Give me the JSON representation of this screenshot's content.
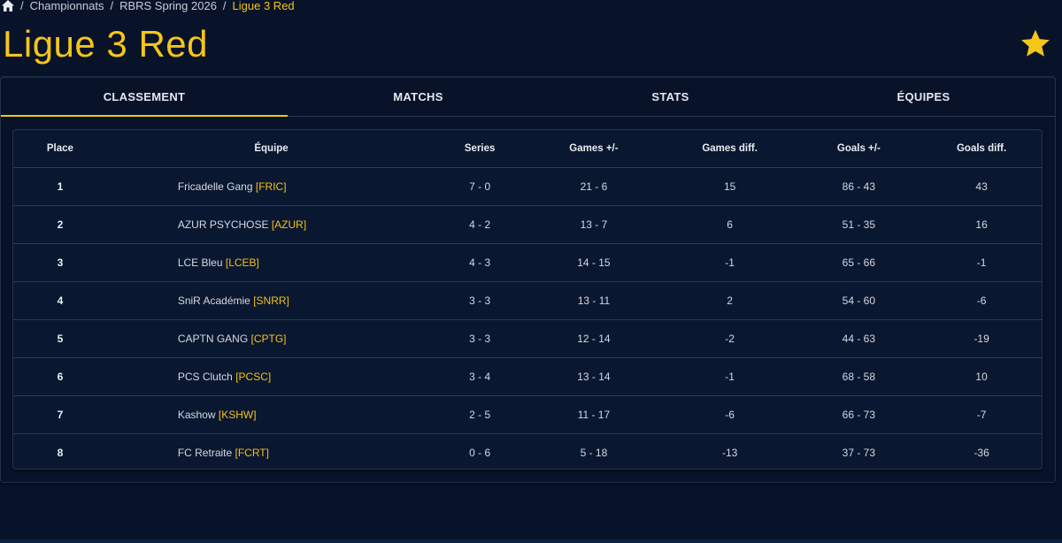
{
  "breadcrumb": {
    "items": [
      "Championnats",
      "RBRS Spring 2026"
    ],
    "current": "Ligue 3 Red"
  },
  "page": {
    "title": "Ligue 3 Red"
  },
  "tabs": [
    {
      "label": "CLASSEMENT",
      "active": true
    },
    {
      "label": "MATCHS",
      "active": false
    },
    {
      "label": "STATS",
      "active": false
    },
    {
      "label": "ÉQUIPES",
      "active": false
    }
  ],
  "table": {
    "headers": {
      "place": "Place",
      "team": "Équipe",
      "series": "Series",
      "games": "Games +/-",
      "games_diff": "Games diff.",
      "goals": "Goals +/-",
      "goals_diff": "Goals diff."
    },
    "rows": [
      {
        "place": "1",
        "name": "Fricadelle Gang",
        "tag": "[FRIC]",
        "series": "7 - 0",
        "games": "21 - 6",
        "games_diff": "15",
        "goals": "86 - 43",
        "goals_diff": "43"
      },
      {
        "place": "2",
        "name": "AZUR PSYCHOSE",
        "tag": "[AZUR]",
        "series": "4 - 2",
        "games": "13 - 7",
        "games_diff": "6",
        "goals": "51 - 35",
        "goals_diff": "16"
      },
      {
        "place": "3",
        "name": "LCE Bleu",
        "tag": "[LCEB]",
        "series": "4 - 3",
        "games": "14 - 15",
        "games_diff": "-1",
        "goals": "65 - 66",
        "goals_diff": "-1"
      },
      {
        "place": "4",
        "name": "SniR Académie",
        "tag": "[SNRR]",
        "series": "3 - 3",
        "games": "13 - 11",
        "games_diff": "2",
        "goals": "54 - 60",
        "goals_diff": "-6"
      },
      {
        "place": "5",
        "name": "CAPTN GANG",
        "tag": "[CPTG]",
        "series": "3 - 3",
        "games": "12 - 14",
        "games_diff": "-2",
        "goals": "44 - 63",
        "goals_diff": "-19"
      },
      {
        "place": "6",
        "name": "PCS Clutch",
        "tag": "[PCSC]",
        "series": "3 - 4",
        "games": "13 - 14",
        "games_diff": "-1",
        "goals": "68 - 58",
        "goals_diff": "10"
      },
      {
        "place": "7",
        "name": "Kashow",
        "tag": "[KSHW]",
        "series": "2 - 5",
        "games": "11 - 17",
        "games_diff": "-6",
        "goals": "66 - 73",
        "goals_diff": "-7"
      },
      {
        "place": "8",
        "name": "FC Retraite",
        "tag": "[FCRT]",
        "series": "0 - 6",
        "games": "5 - 18",
        "games_diff": "-13",
        "goals": "37 - 73",
        "goals_diff": "-36"
      }
    ]
  },
  "colors": {
    "background": "#08132a",
    "accent": "#f5c518",
    "text": "#d9dde6"
  },
  "icons": {
    "home": "home-icon",
    "favorite": "star-icon"
  }
}
